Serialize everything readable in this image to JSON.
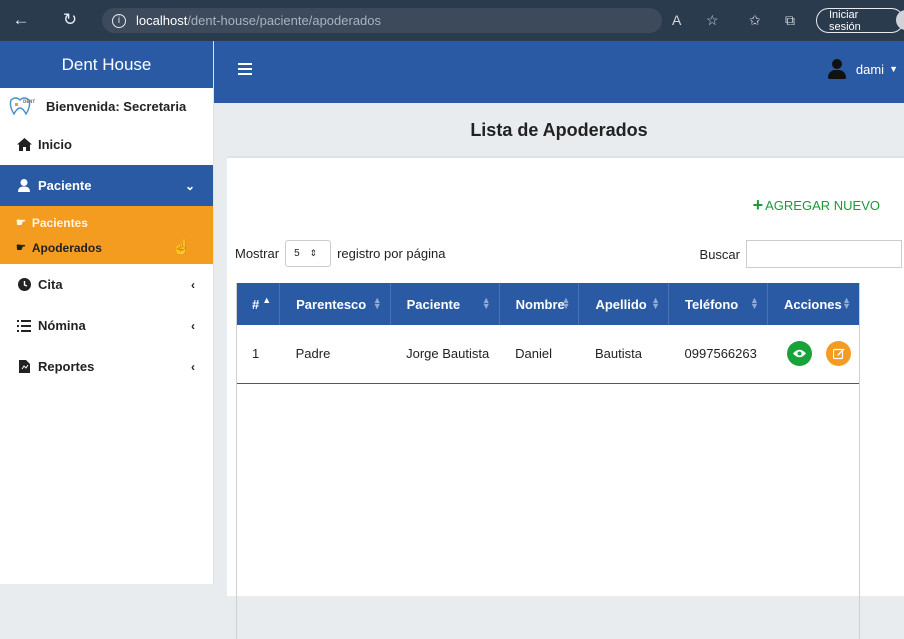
{
  "browser": {
    "url_host": "localhost",
    "url_path": "/dent-house/paciente/apoderados",
    "signin_label": "Iniciar sesión"
  },
  "sidebar": {
    "brand": "Dent House",
    "welcome": "Bienvenida: Secretaria",
    "items": [
      {
        "label": "Inicio",
        "icon": "home-icon"
      },
      {
        "label": "Paciente",
        "icon": "user-icon",
        "arrow": "⌄"
      },
      {
        "label": "Cita",
        "icon": "clock-icon",
        "arrow": "‹"
      },
      {
        "label": "Nómina",
        "icon": "list-icon",
        "arrow": "‹"
      },
      {
        "label": "Reportes",
        "icon": "file-icon",
        "arrow": "‹"
      }
    ],
    "subitems": [
      {
        "label": "Pacientes"
      },
      {
        "label": "Apoderados"
      }
    ]
  },
  "topnav": {
    "username": "dami"
  },
  "main": {
    "title": "Lista de Apoderados",
    "add_label": "AGREGAR NUEVO",
    "show_label": "Mostrar",
    "page_size": "5",
    "per_page_label": "registro por página",
    "search_label": "Buscar",
    "columns": [
      "#",
      "Parentesco",
      "Paciente",
      "Nombre",
      "Apellido",
      "Teléfono",
      "Acciones"
    ],
    "rows": [
      [
        "1",
        "Padre",
        "Jorge Bautista",
        "Daniel",
        "Bautista",
        "0997566263"
      ]
    ]
  },
  "colors": {
    "primary": "#2b5aa5",
    "accent": "#f39c1f",
    "success": "#17a339"
  }
}
